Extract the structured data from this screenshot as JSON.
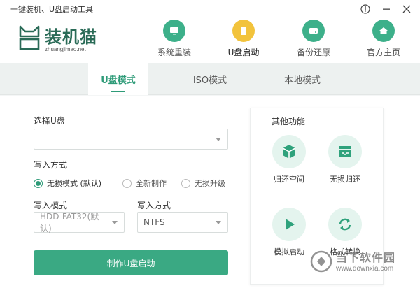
{
  "window": {
    "title": "一键装机、U盘启动工具"
  },
  "brand": {
    "name": "装机猫",
    "site": "zhuangjimao.net",
    "color": "#2a6b57"
  },
  "nav": [
    {
      "label": "系统重装",
      "icon": "monitor-icon",
      "active": false
    },
    {
      "label": "U盘启动",
      "icon": "usb-drive-icon",
      "active": true
    },
    {
      "label": "备份还原",
      "icon": "disk-drive-icon",
      "active": false
    },
    {
      "label": "官方主页",
      "icon": "home-icon",
      "active": false
    }
  ],
  "tabs": [
    {
      "label": "U盘模式",
      "active": true
    },
    {
      "label": "ISO模式",
      "active": false
    },
    {
      "label": "本地模式",
      "active": false
    }
  ],
  "form": {
    "usb_label": "选择U盘",
    "usb_value": "",
    "write_method_label": "写入方式",
    "write_options": [
      {
        "label": "无损模式 (默认)",
        "checked": true
      },
      {
        "label": "全新制作",
        "checked": false
      },
      {
        "label": "无损升级",
        "checked": false
      }
    ],
    "write_mode_label": "写入模式",
    "write_mode_value": "HDD-FAT32(默认)",
    "write_fs_label": "写入方式",
    "write_fs_value": "NTFS",
    "submit_label": "制作U盘启动"
  },
  "side": {
    "title": "其他功能",
    "items": [
      {
        "label": "归还空间",
        "icon": "box-icon"
      },
      {
        "label": "无损归还",
        "icon": "inbox-tray-icon"
      },
      {
        "label": "模拟启动",
        "icon": "play-icon"
      },
      {
        "label": "格式转换",
        "icon": "convert-arrows-icon"
      }
    ]
  },
  "watermark": {
    "text": "当下软件园",
    "url": "www.downxia.com"
  },
  "colors": {
    "accent": "#2e9b78",
    "button": "#3aa983",
    "active_nav": "#f2c33c"
  }
}
